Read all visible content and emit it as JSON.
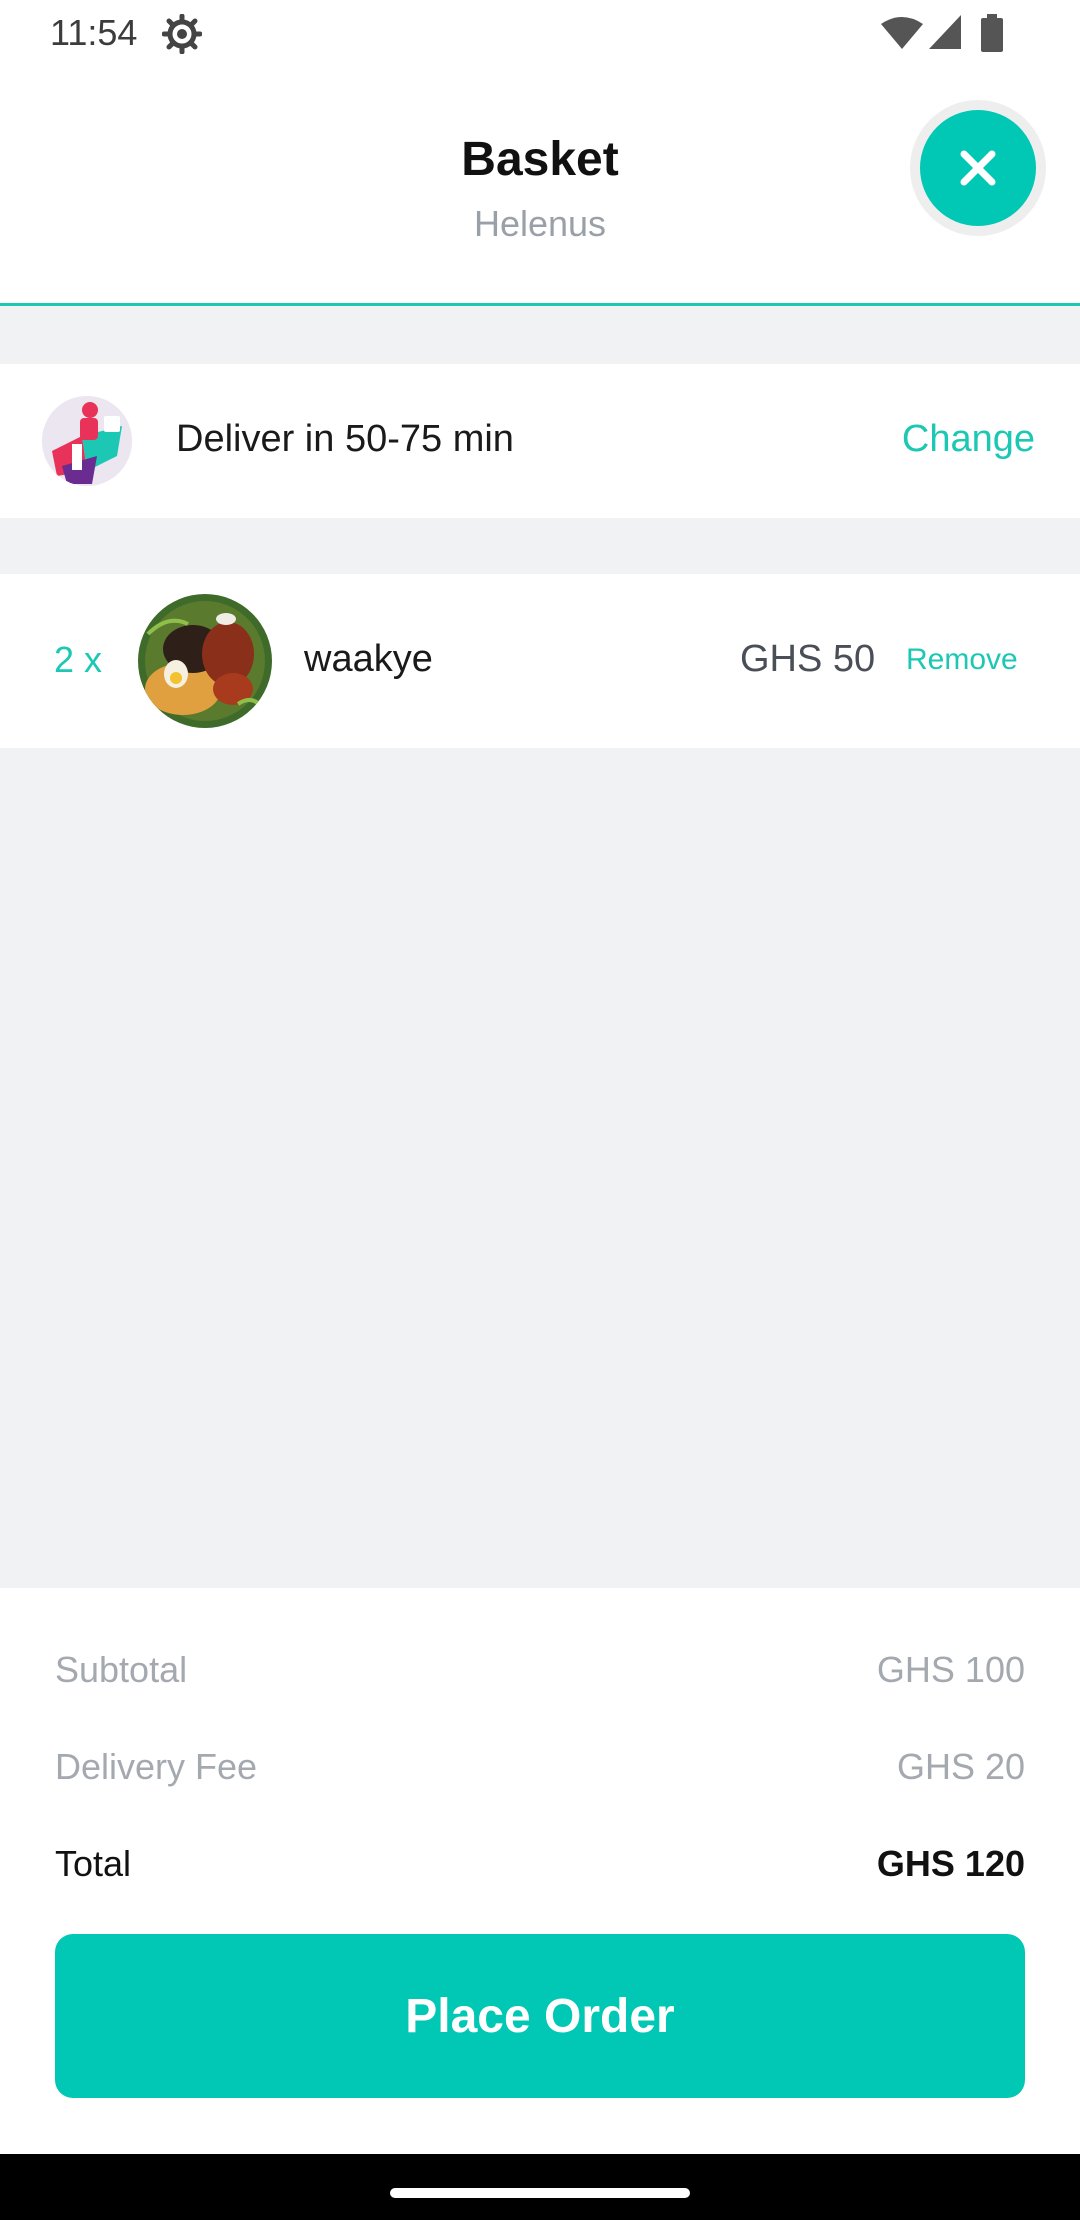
{
  "status_bar": {
    "time": "11:54"
  },
  "header": {
    "title": "Basket",
    "subtitle": "Helenus"
  },
  "delivery": {
    "text": "Deliver in 50-75 min",
    "change_label": "Change"
  },
  "items": [
    {
      "quantity": "2 x",
      "name": "waakye",
      "price": "GHS 50",
      "remove_label": "Remove"
    }
  ],
  "summary": {
    "subtotal_label": "Subtotal",
    "subtotal_value": "GHS 100",
    "delivery_fee_label": "Delivery Fee",
    "delivery_fee_value": "GHS 20",
    "total_label": "Total",
    "total_value": "GHS 120"
  },
  "place_order_label": "Place Order",
  "colors": {
    "accent": "#00c8b4",
    "muted_text": "#a4a9b0",
    "background": "#f1f2f4"
  }
}
